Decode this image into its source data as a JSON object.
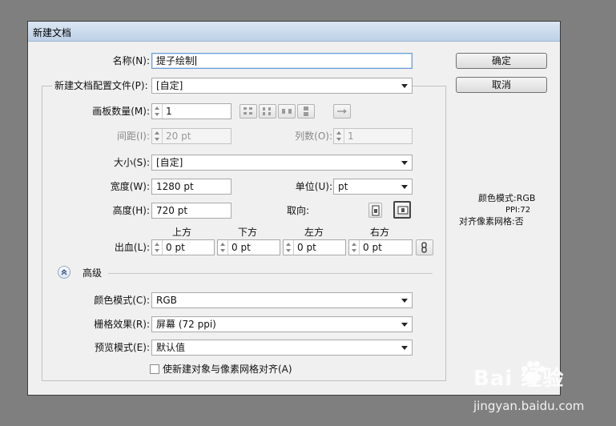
{
  "window": {
    "title": "新建文档"
  },
  "name": {
    "label": "名称(N):",
    "value": "提子绘制"
  },
  "profile": {
    "label": "新建文档配置文件(P):",
    "value": "[自定]"
  },
  "artboards": {
    "label": "画板数量(M):",
    "value": "1"
  },
  "spacing": {
    "label": "间距(I):",
    "value": "20 pt"
  },
  "columns": {
    "label": "列数(O):",
    "value": "1"
  },
  "size": {
    "label": "大小(S):",
    "value": "[自定]"
  },
  "width": {
    "label": "宽度(W):",
    "value": "1280 pt"
  },
  "units": {
    "label": "单位(U):",
    "value": "pt"
  },
  "height": {
    "label": "高度(H):",
    "value": "720 pt"
  },
  "orientation": {
    "label": "取向:",
    "selected": "landscape"
  },
  "bleed": {
    "label": "出血(L):",
    "top_label": "上方",
    "top": "0 pt",
    "bottom_label": "下方",
    "bottom": "0 pt",
    "left_label": "左方",
    "left": "0 pt",
    "right_label": "右方",
    "right": "0 pt"
  },
  "advanced": {
    "label": "高级",
    "color_mode": {
      "label": "颜色模式(C):",
      "value": "RGB"
    },
    "raster": {
      "label": "栅格效果(R):",
      "value": "屏幕 (72 ppi)"
    },
    "preview": {
      "label": "预览模式(E):",
      "value": "默认值"
    },
    "align_pixel": {
      "label": "使新建对象与像素网格对齐(A)",
      "checked": false
    }
  },
  "buttons": {
    "ok": "确定",
    "cancel": "取消"
  },
  "info": {
    "color_mode": "颜色模式:RGB",
    "ppi": "PPI:72",
    "pixel_grid": "对齐像素网格:否"
  },
  "watermark": {
    "logo": "Bai 经验",
    "url": "jingyan.baidu.com"
  },
  "colors": {
    "titlebar": "#bed1e8",
    "dialog_bg": "#f0f0f0",
    "backdrop": "#7f7f7f"
  }
}
